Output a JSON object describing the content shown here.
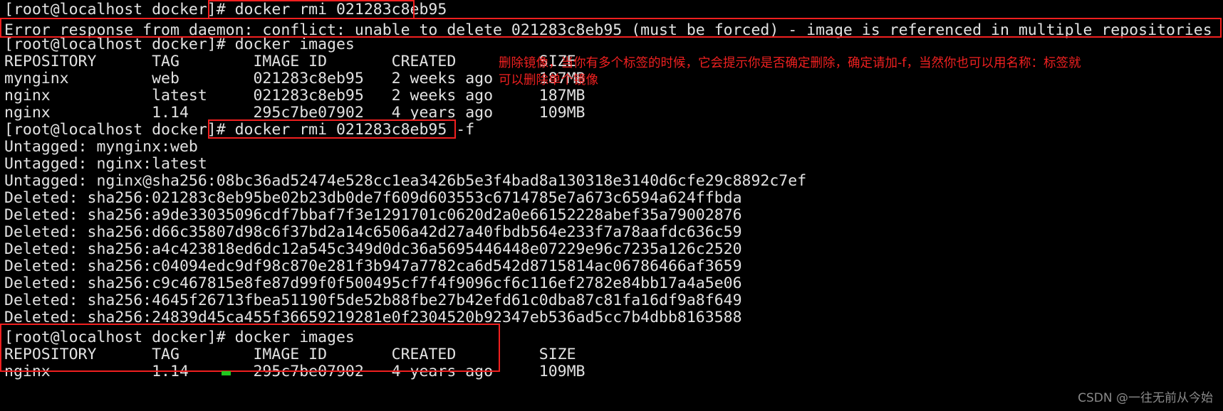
{
  "terminal": {
    "prompt": "[root@localhost docker]#",
    "lines": [
      {
        "id": "cmd-rmi",
        "text": "[root@localhost docker]# docker rmi 021283c8eb95"
      },
      {
        "id": "error-response",
        "text": "Error response from daemon: conflict: unable to delete 021283c8eb95 (must be forced) - image is referenced in multiple repositories"
      },
      {
        "id": "cmd-images-1",
        "text": "[root@localhost docker]# docker images"
      },
      {
        "id": "images-header-1",
        "text": "REPOSITORY      TAG        IMAGE ID       CREATED         SIZE"
      },
      {
        "id": "images-row-mynginx",
        "text": "mynginx         web        021283c8eb95   2 weeks ago     187MB"
      },
      {
        "id": "images-row-nginx-latest",
        "text": "nginx           latest     021283c8eb95   2 weeks ago     187MB"
      },
      {
        "id": "images-row-nginx-114",
        "text": "nginx           1.14       295c7be07902   4 years ago     109MB"
      },
      {
        "id": "cmd-rmi-force",
        "text": "[root@localhost docker]# docker rmi 021283c8eb95 -f"
      },
      {
        "id": "untagged-1",
        "text": "Untagged: mynginx:web"
      },
      {
        "id": "untagged-2",
        "text": "Untagged: nginx:latest"
      },
      {
        "id": "untagged-3",
        "text": "Untagged: nginx@sha256:08bc36ad52474e528cc1ea3426b5e3f4bad8a130318e3140d6cfe29c8892c7ef"
      },
      {
        "id": "deleted-1",
        "text": "Deleted: sha256:021283c8eb95be02b23db0de7f609d603553c6714785e7a673c6594a624ffbda"
      },
      {
        "id": "deleted-2",
        "text": "Deleted: sha256:a9de33035096cdf7bbaf7f3e1291701c0620d2a0e66152228abef35a79002876"
      },
      {
        "id": "deleted-3",
        "text": "Deleted: sha256:d66c35807d98c6f37bd2a14c6506a42d27a40fbdb564e233f7a78aafdc636c59"
      },
      {
        "id": "deleted-4",
        "text": "Deleted: sha256:a4c423818ed6dc12a545c349d0dc36a5695446448e07229e96c7235a126c2520"
      },
      {
        "id": "deleted-5",
        "text": "Deleted: sha256:c04094edc9df98c870e281f3b947a7782ca6d542d8715814ac06786466af3659"
      },
      {
        "id": "deleted-6",
        "text": "Deleted: sha256:c9c467815e8fe87d99f0f500495cf7f4f9096cf6c116ef2782e84bb17a4a5e06"
      },
      {
        "id": "deleted-7",
        "text": "Deleted: sha256:4645f26713fbea51190f5de52b88fbe27b42efd61c0dba87c81fa16df9a8f649"
      },
      {
        "id": "deleted-8",
        "text": "Deleted: sha256:24839d45ca455f36659219281e0f2304520b92347eb536ad5cc7b4dbb8163588"
      },
      {
        "id": "cmd-images-2",
        "text": "[root@localhost docker]# docker images"
      },
      {
        "id": "images-header-2",
        "text": "REPOSITORY      TAG        IMAGE ID       CREATED         SIZE"
      },
      {
        "id": "images-row-final",
        "text": "nginx           1.14       295c7be07902   4 years ago     109MB"
      }
    ]
  },
  "annotation": {
    "line1": "删除镜像，当你有多个标签的时候，它会提示你是否确定删除，确定请加-f，当然你也可以用名称：标签就",
    "line2": "可以删除单个镜像",
    "color": "#ef2020"
  },
  "highlights": [
    {
      "id": "highlight-rmi-command",
      "label": "docker rmi 021283c8eb95"
    },
    {
      "id": "highlight-error-line",
      "label": "Error response from daemon"
    },
    {
      "id": "highlight-rmi-force-command",
      "label": "docker rmi 021283c8eb95 -f"
    },
    {
      "id": "highlight-final-images-output",
      "label": "docker images final output"
    }
  ],
  "cursor": {
    "color": "#1fc81f"
  },
  "watermark": {
    "text": "CSDN @一往无前从今始"
  }
}
